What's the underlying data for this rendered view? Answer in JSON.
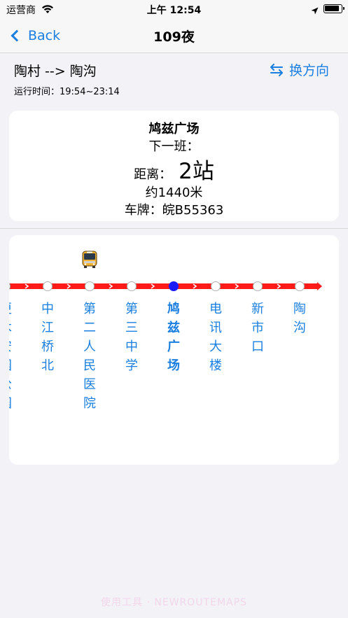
{
  "status_bar": {
    "carrier": "运营商",
    "time": "上午 12:54"
  },
  "nav": {
    "back_label": "Back",
    "title": "109夜"
  },
  "route": {
    "name": "陶村 --> 陶沟",
    "switch_label": "换方向",
    "run_time": "运行时间：19:54~23:14"
  },
  "info": {
    "stop_name": "鸠兹广场",
    "next_bus": "下一班：",
    "distance_label": "距离：",
    "distance_value": "2站",
    "meters": "约1440米",
    "plate": "车牌：皖B55363"
  },
  "stops": [
    {
      "name": "更木安园",
      "chars": [
        "更",
        "木",
        "安",
        "园",
        "公",
        "园"
      ],
      "current": false
    },
    {
      "name": "中江桥北",
      "chars": [
        "中",
        "江",
        "桥",
        "北"
      ],
      "current": false
    },
    {
      "name": "第二人民医院",
      "chars": [
        "第",
        "二",
        "人",
        "民",
        "医",
        "院"
      ],
      "current": false
    },
    {
      "name": "第三中学",
      "chars": [
        "第",
        "三",
        "中",
        "学"
      ],
      "current": false
    },
    {
      "name": "鸠兹广场",
      "chars": [
        "鸠",
        "兹",
        "广",
        "场"
      ],
      "current": true
    },
    {
      "name": "电讯大楼",
      "chars": [
        "电",
        "讯",
        "大",
        "楼"
      ],
      "current": false
    },
    {
      "name": "新市口",
      "chars": [
        "新",
        "市",
        "口"
      ],
      "current": false
    },
    {
      "name": "陶沟",
      "chars": [
        "陶",
        "沟"
      ],
      "current": false
    }
  ],
  "bus_at_stop_index": 2,
  "colors": {
    "accent": "#1a7fe0",
    "route_line": "#ff1a1a",
    "current_stop": "#1a1aff"
  },
  "watermark": "使用工具 · NEWROUTEMAPS"
}
